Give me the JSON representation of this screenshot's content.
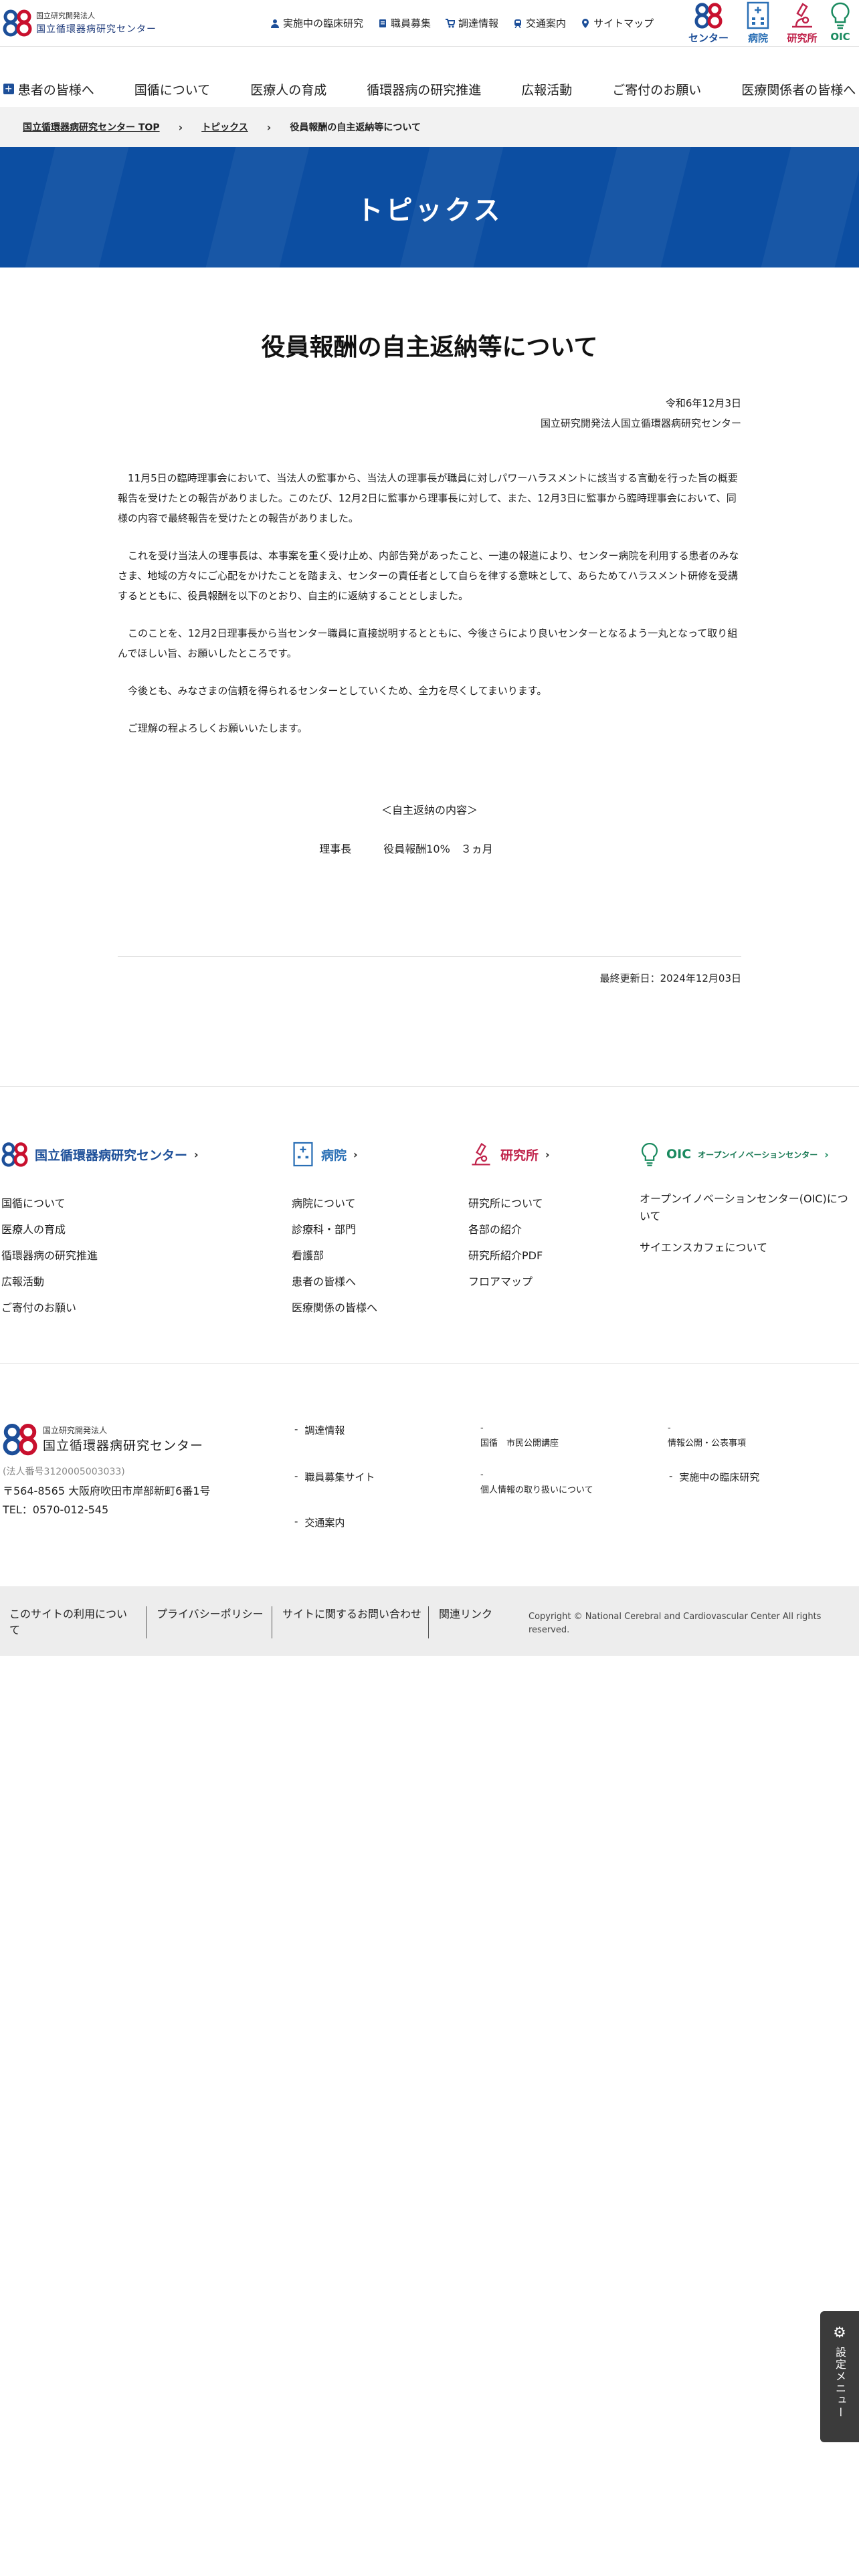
{
  "header": {
    "org_small": "国立研究開発法人",
    "org_name": "国立循環器病研究センター",
    "util_links": [
      {
        "label": "実施中の臨床研究",
        "icon": "person-icon"
      },
      {
        "label": "職員募集",
        "icon": "document-icon"
      },
      {
        "label": "調達情報",
        "icon": "cart-icon"
      },
      {
        "label": "交通案内",
        "icon": "train-icon"
      },
      {
        "label": "サイトマップ",
        "icon": "pin-icon"
      }
    ],
    "site_switch": [
      {
        "label": "センター",
        "color": "#1d4f99"
      },
      {
        "label": "病院",
        "color": "#2a6fb5"
      },
      {
        "label": "研究所",
        "color": "#c0234b"
      },
      {
        "label": "OIC",
        "color": "#1a8a5f"
      }
    ]
  },
  "gnav": [
    "患者の皆様へ",
    "国循について",
    "医療人の育成",
    "循環器病の研究推進",
    "広報活動",
    "ご寄付のお願い",
    "医療関係者の皆様へ"
  ],
  "breadcrumb": {
    "home": "国立循環器病研究センター TOP",
    "section": "トピックス",
    "current": "役員報酬の自主返納等について",
    "sep": "›"
  },
  "banner": {
    "title": "トピックス"
  },
  "article": {
    "title": "役員報酬の自主返納等について",
    "date": "令和6年12月3日",
    "issuer": "国立研究開発法人国立循環器病研究センター",
    "paragraphs": [
      "11月5日の臨時理事会において、当法人の監事から、当法人の理事長が職員に対しパワーハラスメントに該当する言動を行った旨の概要報告を受けたとの報告がありました。このたび、12月2日に監事から理事長に対して、また、12月3日に監事から臨時理事会において、同様の内容で最終報告を受けたとの報告がありました。",
      "これを受け当法人の理事長は、本事案を重く受け止め、内部告発があったこと、一連の報道により、センター病院を利用する患者のみなさま、地域の方々にご心配をかけたことを踏まえ、センターの責任者として自らを律する意味として、あらためてハラスメント研修を受講するとともに、役員報酬を以下のとおり、自主的に返納することとしました。",
      "このことを、12月2日理事長から当センター職員に直接説明するとともに、今後さらにより良いセンターとなるよう一丸となって取り組んでほしい旨、お願いしたところです。",
      "今後とも、みなさまの信頼を得られるセンターとしていくため、全力を尽くしてまいります。",
      "ご理解の程よろしくお願いいたします。"
    ],
    "refund_heading": "＜自主返納の内容＞",
    "refund_line": "理事長　　　役員報酬10%　３ヵ月",
    "updated": "最終更新日：2024年12月03日"
  },
  "footer_cols": [
    {
      "title": "国立循環器病研究センター",
      "color": "#1d4f99",
      "items": [
        "国循について",
        "医療人の育成",
        "循環器病の研究推進",
        "広報活動",
        "ご寄付のお願い"
      ]
    },
    {
      "title": "病院",
      "color": "#2a6fb5",
      "items": [
        "病院について",
        "診療科・部門",
        "看護部",
        "患者の皆様へ",
        "医療関係の皆様へ"
      ]
    },
    {
      "title": "研究所",
      "color": "#c0234b",
      "items": [
        "研究所について",
        "各部の紹介",
        "研究所紹介PDF",
        "フロアマップ"
      ]
    },
    {
      "title": "OIC",
      "subtitle": "オープンイノベーションセンター",
      "color": "#1a8a5f",
      "items": [
        "オープンイノベーションセンター(OIC)について",
        "サイエンスカフェについて"
      ]
    }
  ],
  "footer_info": {
    "org_small": "国立研究開発法人",
    "org_name": "国立循環器病研究センター",
    "corp_no": "(法人番号3120005003033)",
    "address": "〒564-8565 大阪府吹田市岸部新町6番1号",
    "tel": "TEL：0570-012-545"
  },
  "footer_links": [
    "調達情報",
    "国循　市民公開講座",
    "情報公開・公表事項",
    "職員募集サイト",
    "個人情報の取り扱いについて",
    "実施中の臨床研究",
    "交通案内"
  ],
  "bottom_bar": {
    "links": [
      "このサイトの利用について",
      "プライバシーポリシー",
      "サイトに関するお問い合わせ",
      "関連リンク"
    ],
    "copyright": "Copyright © National Cerebral and Cardiovascular Center All rights reserved."
  },
  "settings": {
    "label": "設定メニュー"
  }
}
